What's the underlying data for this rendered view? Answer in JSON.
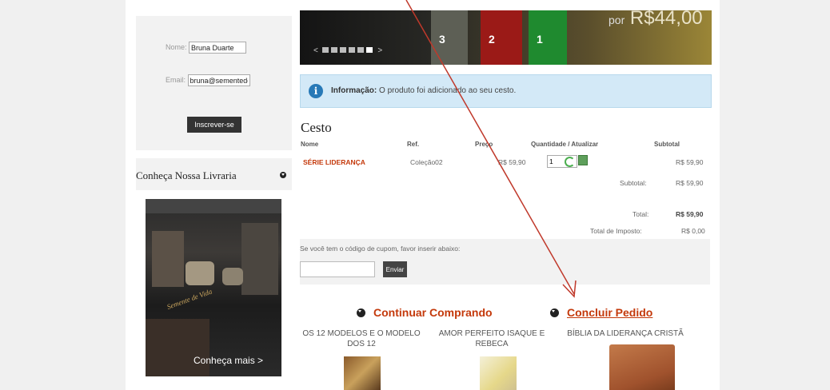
{
  "newsletter": {
    "name_label": "Nome:",
    "name_value": "Bruna Duarte",
    "email_label": "Email:",
    "email_value": "bruna@sementede",
    "subscribe_label": "Inscrever-se"
  },
  "sidebar": {
    "livraria_title": "Conheça Nossa Livraria",
    "store_link": "Conheça mais >"
  },
  "banner": {
    "price_prefix": "por",
    "price": "R$44,00",
    "book_numbers": [
      "3",
      "2",
      "1"
    ]
  },
  "info": {
    "label": "Informação:",
    "message": "O produto foi adicionado ao seu cesto."
  },
  "cart": {
    "title": "Cesto",
    "headers": {
      "name": "Nome",
      "ref": "Ref.",
      "price": "Preço",
      "qty": "Quantidade / Atualizar",
      "subtotal": "Subtotal"
    },
    "rows": [
      {
        "name": "SÉRIE LIDERANÇA",
        "ref": "Coleção02",
        "price": "R$ 59,90",
        "qty": "1",
        "subtotal": "R$ 59,90"
      }
    ],
    "totals": {
      "subtotal_label": "Subtotal:",
      "subtotal_value": "R$ 59,90",
      "total_label": "Total:",
      "total_value": "R$ 59,90",
      "tax_label": "Total de Imposto:",
      "tax_value": "R$ 0,00"
    }
  },
  "coupon": {
    "prompt": "Se você tem o código de cupom, favor inserir abaixo:",
    "button": "Enviar"
  },
  "actions": {
    "continue": "Continuar Comprando",
    "checkout": "Concluir Pedido"
  },
  "products": [
    {
      "title": "OS 12 MODELOS E O MODELO DOS 12"
    },
    {
      "title": "AMOR PERFEITO ISAQUE E REBECA"
    },
    {
      "title": "BÍBLIA DA LIDERANÇA CRISTÃ"
    }
  ],
  "colors": {
    "accent": "#c4390b",
    "info_bg": "#d3e9f7",
    "arrow": "#c0392b"
  }
}
